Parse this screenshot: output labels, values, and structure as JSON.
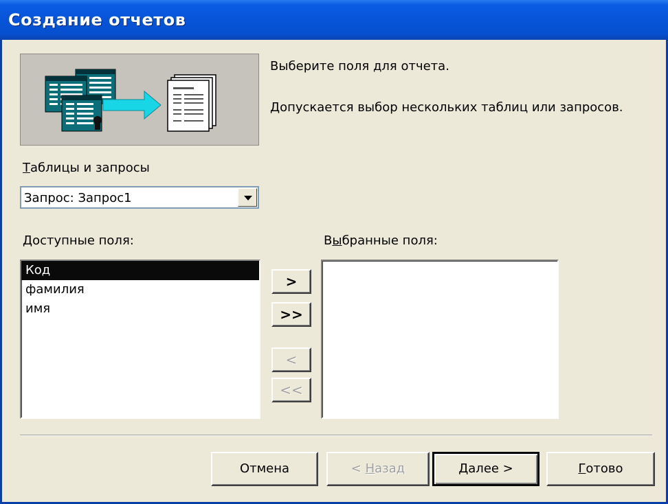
{
  "window": {
    "title": "Создание отчетов"
  },
  "intro": {
    "line1": "Выберите поля для отчета.",
    "line2": "Допускается выбор нескольких таблиц или запросов."
  },
  "tables_queries": {
    "label_first": "Т",
    "label_rest": "аблицы и запросы",
    "selected_value": "Запрос: Запрос1"
  },
  "available_fields": {
    "label_first": "Д",
    "label_rest": "оступные поля:",
    "items": [
      "Код",
      "фамилия",
      "имя"
    ],
    "selected_index": 0
  },
  "selected_fields": {
    "label_pre": "В",
    "label_u": "ы",
    "label_rest": "бранные поля:",
    "items": []
  },
  "move_buttons": {
    "add_one": ">",
    "add_all": ">>",
    "remove_one": "<",
    "remove_all": "<<"
  },
  "buttons": {
    "cancel": "Отмена",
    "back_pre": "< ",
    "back_u": "Н",
    "back_rest": "азад",
    "next_u": "Д",
    "next_rest": "алее >",
    "finish_u": "Г",
    "finish_rest": "отово"
  },
  "icons": {
    "banner": "tables-to-report-icon"
  }
}
